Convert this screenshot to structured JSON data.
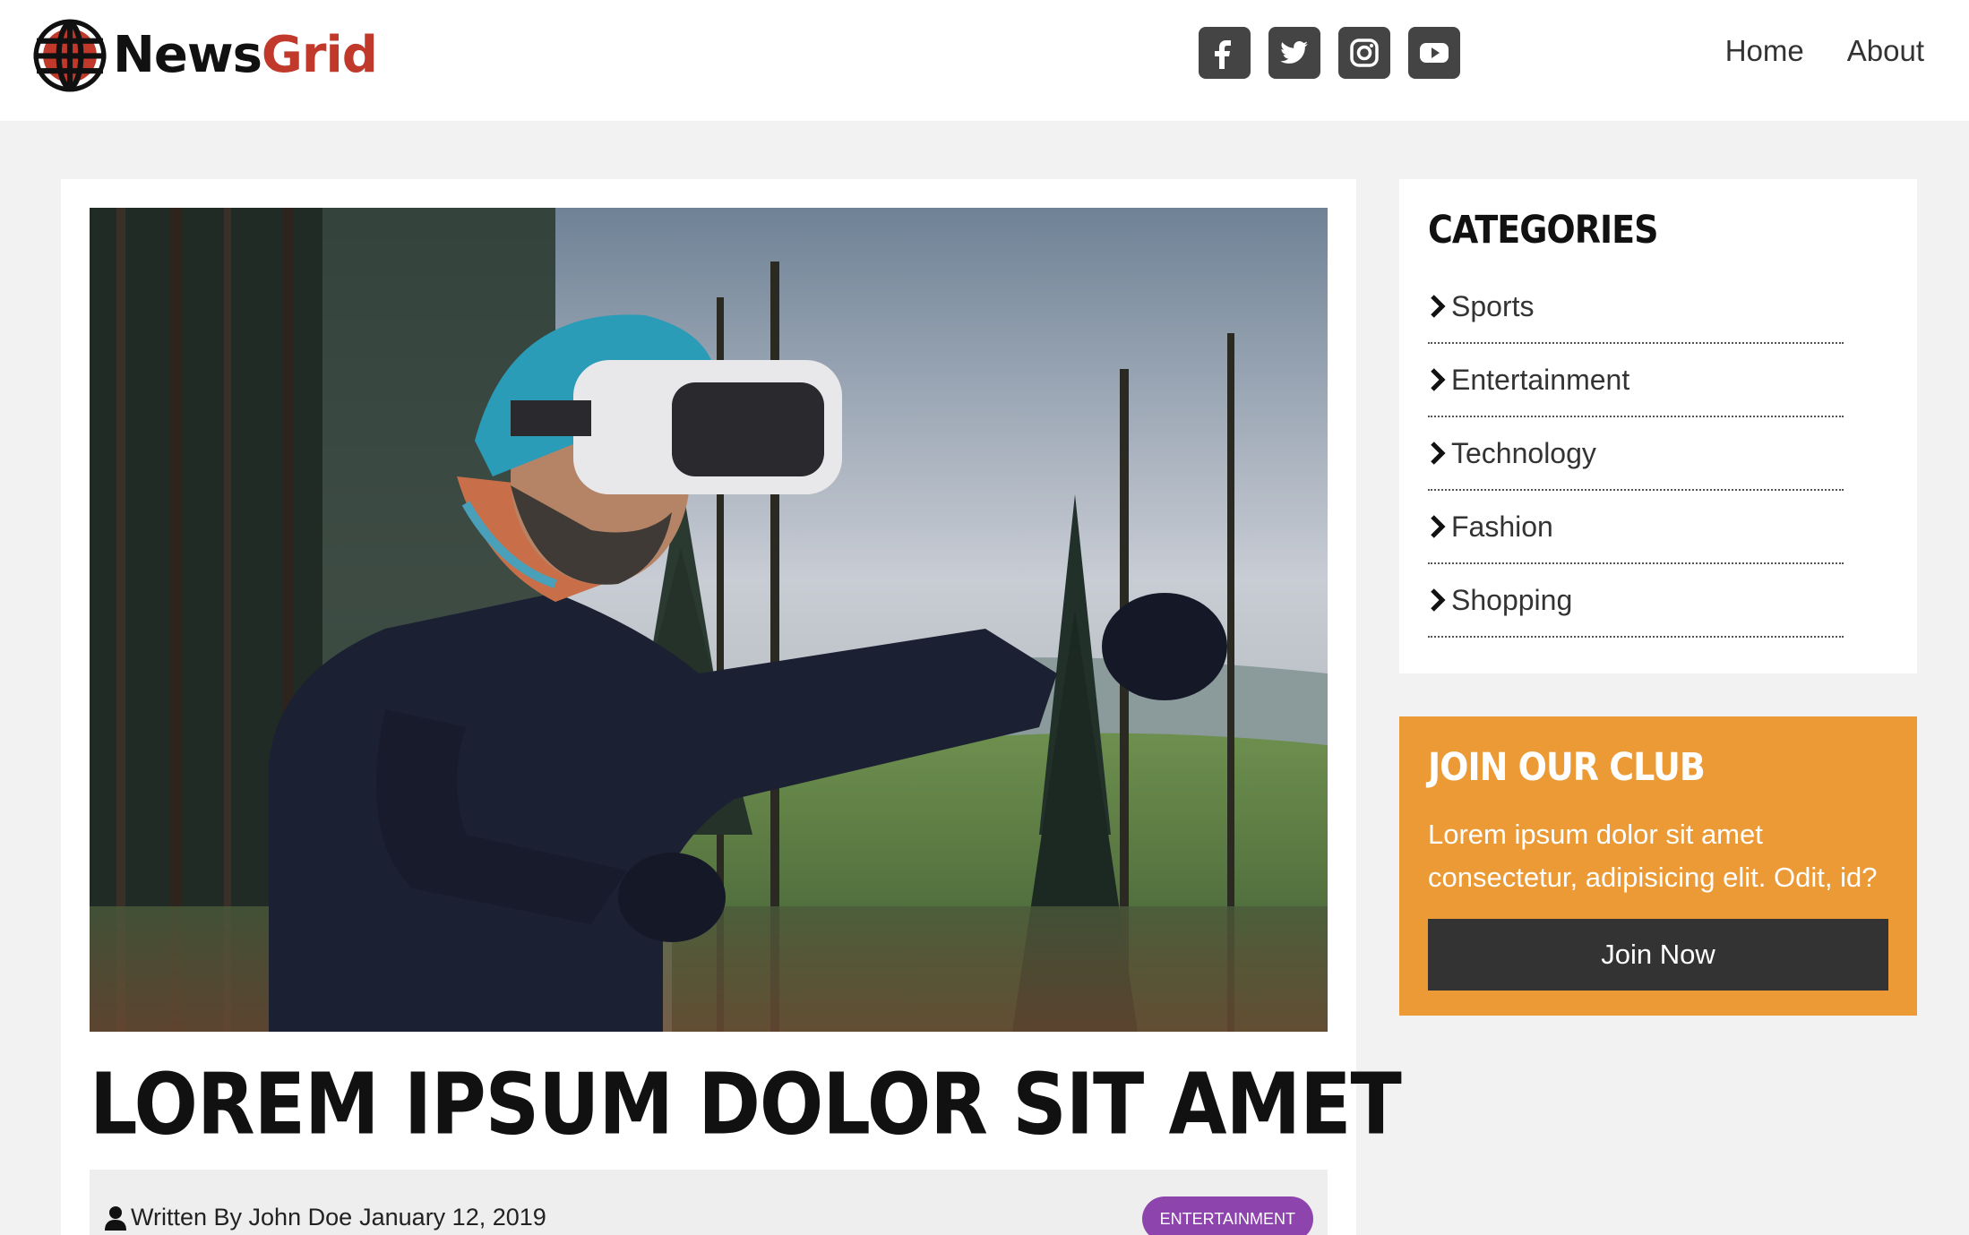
{
  "header": {
    "brand_first": "News",
    "brand_second": "Grid",
    "brand_colors": {
      "first": "#111111",
      "second": "#c0392b"
    },
    "social_icons": [
      "facebook-icon",
      "twitter-icon",
      "instagram-icon",
      "youtube-icon"
    ],
    "nav": {
      "home": "Home",
      "about": "About"
    }
  },
  "article": {
    "title": "LOREM IPSUM DOLOR SIT AMET",
    "author_line": "Written By John Doe",
    "date": "January 12, 2019",
    "category": "ENTERTAINMENT",
    "category_color": "#8e44ad"
  },
  "sidebar": {
    "categories_title": "CATEGORIES",
    "categories": [
      {
        "label": "Sports"
      },
      {
        "label": "Entertainment"
      },
      {
        "label": "Technology"
      },
      {
        "label": "Fashion"
      },
      {
        "label": "Shopping"
      }
    ],
    "club": {
      "title": "JOIN OUR CLUB",
      "text": "Lorem ipsum dolor sit amet consectetur, adipisicing elit. Odit, id?",
      "button": "Join Now",
      "background_color": "#eb9a36"
    }
  }
}
